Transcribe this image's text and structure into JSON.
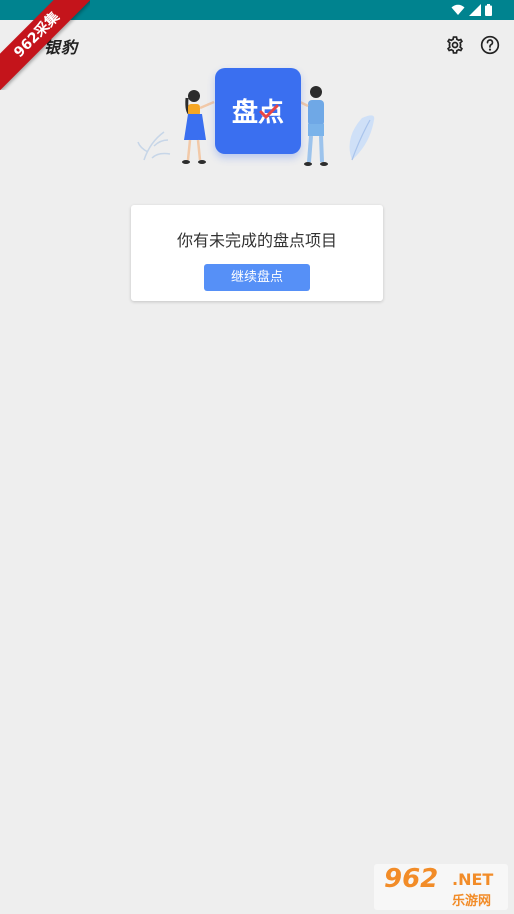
{
  "header": {
    "title": "银豹",
    "settings_icon": "gear-icon",
    "help_icon": "help-circle-icon"
  },
  "illustration": {
    "board_text": "盘点"
  },
  "card": {
    "message": "你有未完成的盘点项目",
    "button_label": "继续盘点"
  },
  "watermark": {
    "ribbon_text": "962采集",
    "number_text": "962",
    "net_text": ".NET",
    "sub_text": "乐游网"
  },
  "colors": {
    "status_bar": "#00838f",
    "accent": "#5690f7",
    "board": "#3a6ff0",
    "background": "#eeeeee"
  }
}
